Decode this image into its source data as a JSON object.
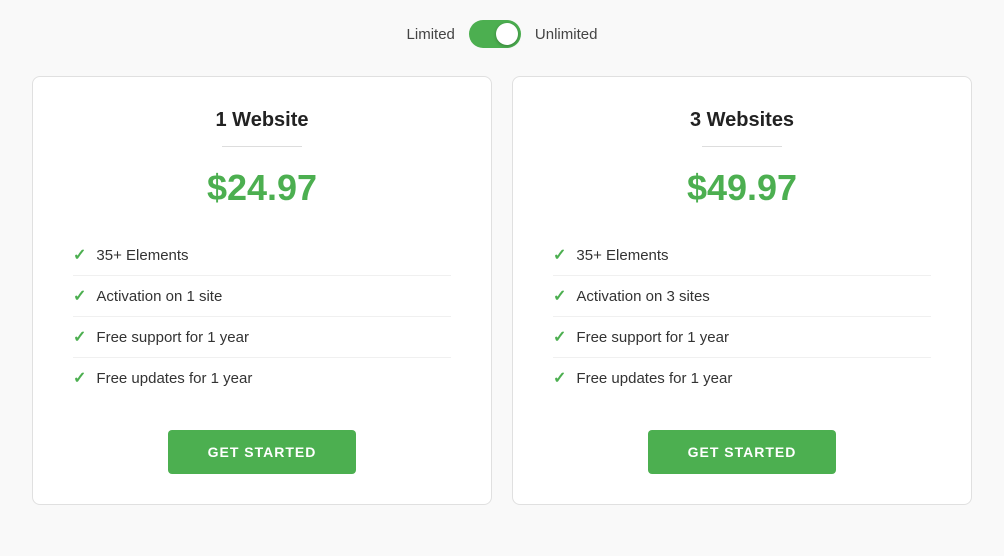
{
  "toggle": {
    "left_label": "Limited",
    "right_label": "Unlimited",
    "state": "unlimited"
  },
  "cards": [
    {
      "id": "one-website",
      "title": "1 Website",
      "price": "$24.97",
      "features": [
        "35+ Elements",
        "Activation on 1 site",
        "Free support for 1 year",
        "Free updates for 1 year"
      ],
      "button_label": "GET STARTED"
    },
    {
      "id": "three-websites",
      "title": "3 Websites",
      "price": "$49.97",
      "features": [
        "35+ Elements",
        "Activation on 3 sites",
        "Free support for 1 year",
        "Free updates for 1 year"
      ],
      "button_label": "GET STARTED"
    }
  ]
}
